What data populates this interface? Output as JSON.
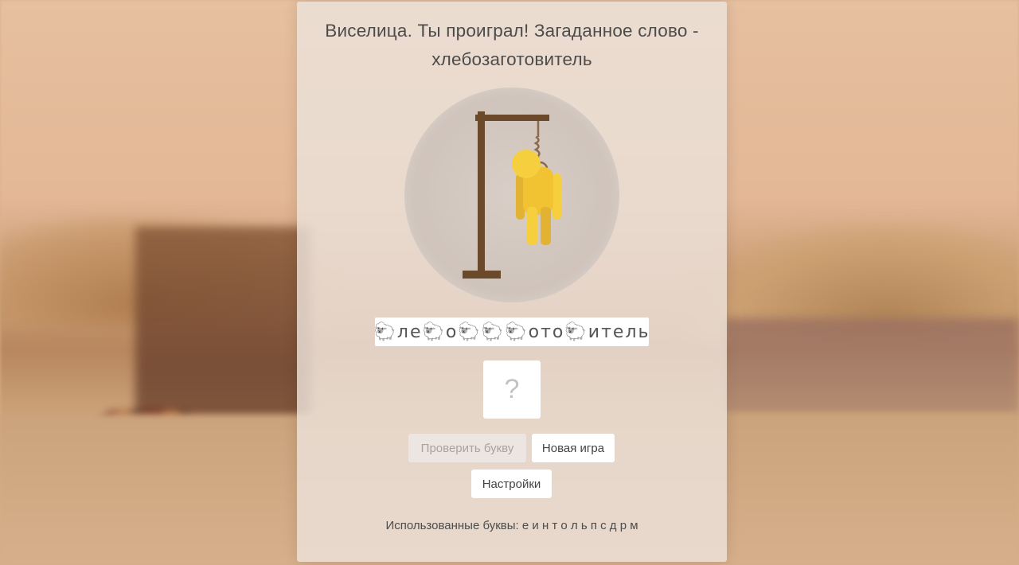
{
  "title": "Виселица. Ты проиграл! Загаданное слово - хлебозаготовитель",
  "word_display": [
    "🐑",
    "л",
    "е",
    "🐑",
    "о",
    "🐑",
    "🐑",
    "🐑",
    "о",
    "т",
    "о",
    "🐑",
    "и",
    "т",
    "е",
    "л",
    "ь"
  ],
  "letter_input": {
    "value": "",
    "placeholder": "?"
  },
  "buttons": {
    "check_letter": "Проверить букву",
    "new_game": "Новая игра",
    "settings": "Настройки"
  },
  "used_letters": {
    "label": "Использованные буквы:",
    "letters": "е и н т о л ь п с д р м"
  },
  "colors": {
    "gallows": "#6b4a2b",
    "figure": "#f5cf3d",
    "figure_shadow": "#e2b333",
    "rope": "#8b6a4a"
  }
}
